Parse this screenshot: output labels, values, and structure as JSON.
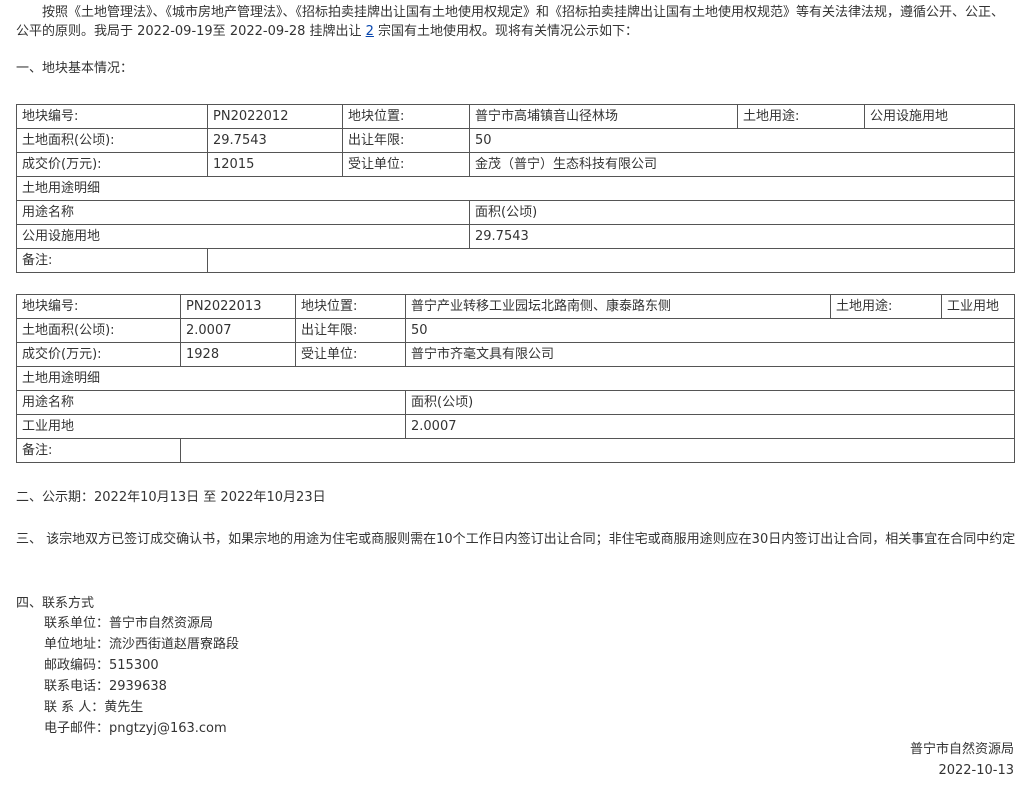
{
  "intro": {
    "text_before": "按照《土地管理法》、《城市房地产管理法》、《招标拍卖挂牌出让国有土地使用权规定》和《招标拍卖挂牌出让国有土地使用权规范》等有关法律法规，遵循公开、公正、公平的原则。我局于 2022-09-19至 2022-09-28 挂牌出让 ",
    "count_link": "2",
    "text_after": " 宗国有土地使用权。现将有关情况公示如下："
  },
  "section1_title": "一、地块基本情况：",
  "labels": {
    "plot_no": "地块编号:",
    "location": "地块位置:",
    "use": "土地用途:",
    "area": "土地面积(公顷):",
    "term": "出让年限:",
    "price": "成交价(万元):",
    "buyer": "受让单位:",
    "use_detail": "土地用途明细",
    "use_name": "用途名称",
    "use_area": "面积(公顷)",
    "remark": "备注:"
  },
  "plots": [
    {
      "plot_no": "PN2022012",
      "location": "普宁市高埔镇音山径林场",
      "use": "公用设施用地",
      "area": "29.7543",
      "term": "50",
      "price": "12015",
      "buyer": "金茂（普宁）生态科技有限公司",
      "detail_use": "公用设施用地",
      "detail_area": "29.7543",
      "remark": ""
    },
    {
      "plot_no": "PN2022013",
      "location": "普宁产业转移工业园坛北路南侧、康泰路东侧",
      "use": "工业用地",
      "area": "2.0007",
      "term": "50",
      "price": "1928",
      "buyer": "普宁市齐毫文具有限公司",
      "detail_use": "工业用地",
      "detail_area": "2.0007",
      "remark": ""
    }
  ],
  "section2": "二、公示期：2022年10月13日 至 2022年10月23日",
  "section3": "三、 该宗地双方已签订成交确认书，如果宗地的用途为住宅或商服则需在10个工作日内签订出让合同；非住宅或商服用途则应在30日内签订出让合同，相关事宜在合同中约定",
  "section4_title": "四、联系方式",
  "contact": {
    "unit": "联系单位：普宁市自然资源局",
    "address": "单位地址：流沙西街道赵厝寮路段",
    "postcode": "邮政编码：515300",
    "phone": "联系电话：2939638",
    "person": "联 系 人：黄先生",
    "email": "电子邮件：pngtzyj@163.com"
  },
  "signature": {
    "org": "普宁市自然资源局",
    "date": "2022-10-13"
  }
}
